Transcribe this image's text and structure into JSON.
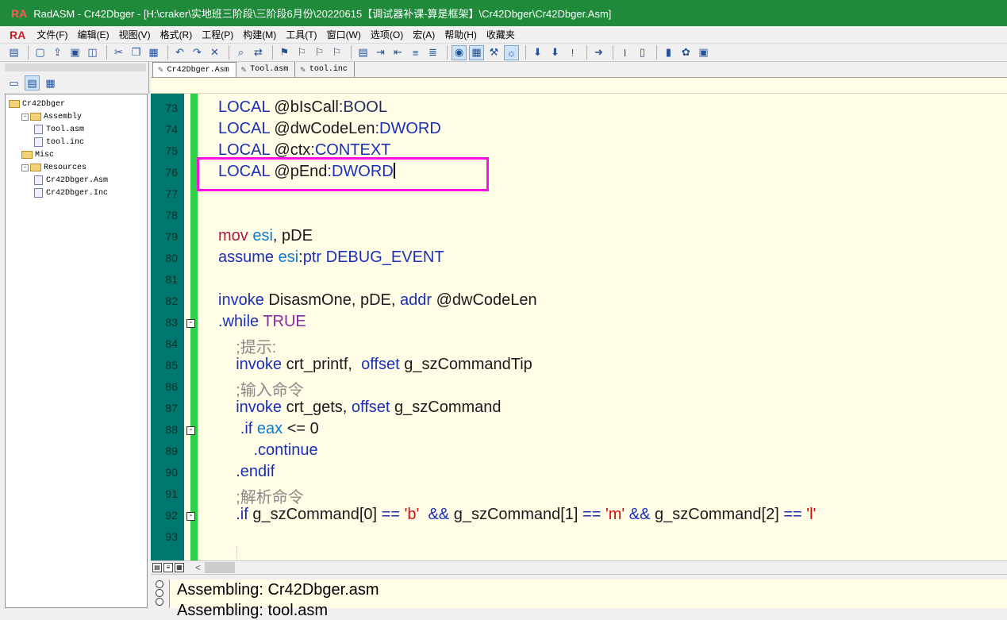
{
  "window": {
    "app_logo": "RA",
    "title": "RadASM - Cr42Dbger - [H:\\craker\\实地班三阶段\\三阶段6月份\\20220615【调试器补课-算是框架】\\Cr42Dbger\\Cr42Dbger.Asm]"
  },
  "menu": [
    "文件(F)",
    "编辑(E)",
    "视图(V)",
    "格式(R)",
    "工程(P)",
    "构建(M)",
    "工具(T)",
    "窗口(W)",
    "选项(O)",
    "宏(A)",
    "帮助(H)",
    "收藏夹"
  ],
  "toolbar": {
    "buttons": [
      {
        "name": "print-icon",
        "glyph": "▤"
      },
      {
        "sep": true
      },
      {
        "name": "new-file-icon",
        "glyph": "▢"
      },
      {
        "name": "open-file-icon",
        "glyph": "⇪"
      },
      {
        "name": "save-icon",
        "glyph": "▣"
      },
      {
        "name": "save-all-icon",
        "glyph": "◫"
      },
      {
        "sep": true
      },
      {
        "name": "cut-icon",
        "glyph": "✂"
      },
      {
        "name": "copy-icon",
        "glyph": "❐"
      },
      {
        "name": "paste-icon",
        "glyph": "▦"
      },
      {
        "sep": true
      },
      {
        "name": "undo-icon",
        "glyph": "↶"
      },
      {
        "name": "redo-icon",
        "glyph": "↷"
      },
      {
        "name": "delete-icon",
        "glyph": "✕"
      },
      {
        "sep": true
      },
      {
        "name": "find-icon",
        "glyph": "⌕"
      },
      {
        "name": "replace-icon",
        "glyph": "⇄"
      },
      {
        "sep": true
      },
      {
        "name": "bookmark-toggle-icon",
        "glyph": "⚑"
      },
      {
        "name": "bookmark-next-icon",
        "glyph": "⚐"
      },
      {
        "name": "bookmark-prev-icon",
        "glyph": "⚐"
      },
      {
        "name": "bookmark-clear-icon",
        "glyph": "⚐"
      },
      {
        "sep": true
      },
      {
        "name": "outline-icon",
        "glyph": "▤"
      },
      {
        "name": "indent-icon",
        "glyph": "⇥"
      },
      {
        "name": "outdent-icon",
        "glyph": "⇤"
      },
      {
        "name": "comment-icon",
        "glyph": "≡"
      },
      {
        "name": "uncomment-icon",
        "glyph": "≣"
      },
      {
        "sep": true
      },
      {
        "name": "view-project-icon",
        "glyph": "◉",
        "sel": true
      },
      {
        "name": "view-properties-icon",
        "glyph": "▦",
        "sel": true
      },
      {
        "name": "tools-icon",
        "glyph": "⚒"
      },
      {
        "name": "output-window-icon",
        "glyph": "☼",
        "sel": true
      },
      {
        "sep": true
      },
      {
        "name": "assemble-icon",
        "glyph": "⬇"
      },
      {
        "name": "build-icon",
        "glyph": "⬇"
      },
      {
        "name": "go-icon",
        "glyph": "!"
      },
      {
        "sep": true
      },
      {
        "name": "run-icon",
        "glyph": "➜"
      },
      {
        "sep": true
      },
      {
        "name": "text-cursor-icon",
        "glyph": "I"
      },
      {
        "name": "document-icon",
        "glyph": "▯"
      },
      {
        "sep": true
      },
      {
        "name": "color-bars-icon",
        "glyph": "▮"
      },
      {
        "name": "palette-icon",
        "glyph": "✿"
      },
      {
        "name": "preview-icon",
        "glyph": "▣"
      }
    ]
  },
  "sidebar": {
    "tree": [
      {
        "label": "Cr42Dbger",
        "indent": 0,
        "kind": "folder"
      },
      {
        "label": "Assembly",
        "indent": 1,
        "kind": "folder",
        "expander": "-"
      },
      {
        "label": "Tool.asm",
        "indent": 2,
        "kind": "file"
      },
      {
        "label": "tool.inc",
        "indent": 2,
        "kind": "file"
      },
      {
        "label": "Misc",
        "indent": 1,
        "kind": "folder"
      },
      {
        "label": "Resources",
        "indent": 1,
        "kind": "folder",
        "expander": "-"
      },
      {
        "label": "Cr42Dbger.Asm",
        "indent": 2,
        "kind": "file"
      },
      {
        "label": "Cr42Dbger.Inc",
        "indent": 2,
        "kind": "file"
      }
    ]
  },
  "tabs": [
    {
      "label": "Cr42Dbger.Asm",
      "active": true
    },
    {
      "label": "Tool.asm",
      "active": false
    },
    {
      "label": "tool.inc",
      "active": false
    }
  ],
  "editor": {
    "lines": [
      {
        "no": "73",
        "tokens": [
          [
            "k",
            "LOCAL "
          ],
          [
            "v",
            "@bIsCall"
          ],
          [
            "t",
            ":BOOL"
          ]
        ]
      },
      {
        "no": "74",
        "tokens": [
          [
            "k",
            "LOCAL "
          ],
          [
            "v",
            "@dwCodeLen"
          ],
          [
            "k",
            ":DWORD"
          ]
        ]
      },
      {
        "no": "75",
        "tokens": [
          [
            "k",
            "LOCAL "
          ],
          [
            "v",
            "@ctx"
          ],
          [
            "t",
            ":"
          ],
          [
            "k",
            "CONTEXT"
          ]
        ]
      },
      {
        "no": "76",
        "tokens": [
          [
            "k",
            "LOCAL "
          ],
          [
            "v",
            "@pEnd"
          ],
          [
            "k",
            ":DWORD"
          ]
        ],
        "caret": true
      },
      {
        "no": "77",
        "tokens": []
      },
      {
        "no": "78",
        "tokens": []
      },
      {
        "no": "79",
        "tokens": [
          [
            "m",
            "mov "
          ],
          [
            "r",
            "esi"
          ],
          [
            "v",
            ", pDE"
          ]
        ]
      },
      {
        "no": "80",
        "tokens": [
          [
            "k",
            "assume "
          ],
          [
            "r",
            "esi"
          ],
          [
            "v",
            ":"
          ],
          [
            "k",
            "ptr "
          ],
          [
            "k",
            "DEBUG_EVENT"
          ]
        ]
      },
      {
        "no": "81",
        "tokens": []
      },
      {
        "no": "82",
        "tokens": [
          [
            "k",
            "invoke "
          ],
          [
            "v",
            "DisasmOne, pDE, "
          ],
          [
            "k",
            "addr "
          ],
          [
            "v",
            "@dwCodeLen"
          ]
        ]
      },
      {
        "no": "83",
        "fold": "-",
        "tokens": [
          [
            "k",
            ".while "
          ],
          [
            "p",
            "TRUE"
          ]
        ]
      },
      {
        "no": "84",
        "tokens": [
          [
            "c",
            "    ;提示:"
          ]
        ]
      },
      {
        "no": "85",
        "tokens": [
          [
            "v",
            "    "
          ],
          [
            "k",
            "invoke "
          ],
          [
            "v",
            "crt_printf,  "
          ],
          [
            "k",
            "offset "
          ],
          [
            "v",
            "g_szCommandTip"
          ]
        ]
      },
      {
        "no": "86",
        "tokens": [
          [
            "c",
            "    ;输入命令"
          ]
        ]
      },
      {
        "no": "87",
        "tokens": [
          [
            "v",
            "    "
          ],
          [
            "k",
            "invoke "
          ],
          [
            "v",
            "crt_gets, "
          ],
          [
            "k",
            "offset "
          ],
          [
            "v",
            "g_szCommand"
          ]
        ]
      },
      {
        "no": "88",
        "fold": "-",
        "tokens": [
          [
            "v",
            "     "
          ],
          [
            "k",
            ".if "
          ],
          [
            "r",
            "eax "
          ],
          [
            "v",
            "<= 0"
          ]
        ]
      },
      {
        "no": "89",
        "tokens": [
          [
            "v",
            "        "
          ],
          [
            "k",
            ".continue"
          ]
        ]
      },
      {
        "no": "90",
        "tokens": [
          [
            "v",
            "    "
          ],
          [
            "k",
            ".endif"
          ]
        ]
      },
      {
        "no": "91",
        "tokens": [
          [
            "c",
            "    ;解析命令"
          ]
        ]
      },
      {
        "no": "92",
        "fold": "-",
        "tokens": [
          [
            "v",
            "    "
          ],
          [
            "k",
            ".if "
          ],
          [
            "v",
            "g_szCommand[0] "
          ],
          [
            "k",
            "== "
          ],
          [
            "s",
            "'b' "
          ],
          [
            "v",
            " "
          ],
          [
            "k",
            "&& "
          ],
          [
            "v",
            "g_szCommand[1] "
          ],
          [
            "k",
            "== "
          ],
          [
            "s",
            "'m' "
          ],
          [
            "k",
            "&& "
          ],
          [
            "v",
            "g_szCommand[2] "
          ],
          [
            "k",
            "== "
          ],
          [
            "s",
            "'l'"
          ]
        ]
      },
      {
        "no": "93",
        "tokens": []
      }
    ]
  },
  "output": {
    "lines": [
      "Assembling: Cr42Dbger.asm",
      "Assembling: tool.asm"
    ]
  },
  "colors": {
    "gutter": "#00776e",
    "margin_green": "#2ed24a",
    "editor_bg": "#fffde6",
    "highlight_box": "#ff10e0",
    "titlebar": "#1e8a3a"
  }
}
